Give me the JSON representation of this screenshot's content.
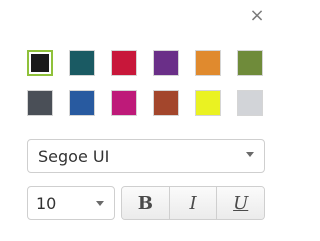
{
  "panel": {
    "close_glyph": "×",
    "close_icon": "close-icon"
  },
  "swatches": {
    "selected_index": 0,
    "row1": [
      {
        "name": "black",
        "color": "#1a1a1a"
      },
      {
        "name": "teal",
        "color": "#1a5a63"
      },
      {
        "name": "crimson",
        "color": "#c8173a"
      },
      {
        "name": "purple",
        "color": "#6a2f88"
      },
      {
        "name": "orange",
        "color": "#e08a2e"
      },
      {
        "name": "olive",
        "color": "#6f8b3a"
      }
    ],
    "row2": [
      {
        "name": "slate",
        "color": "#4a4f57"
      },
      {
        "name": "blue",
        "color": "#285aa0"
      },
      {
        "name": "magenta",
        "color": "#be1a79"
      },
      {
        "name": "brown",
        "color": "#a3462c"
      },
      {
        "name": "yellow",
        "color": "#eaf222"
      },
      {
        "name": "light-gray",
        "color": "#d2d4d8"
      }
    ]
  },
  "font": {
    "family": "Segoe UI"
  },
  "size": {
    "value": "10"
  },
  "style_buttons": {
    "bold": "B",
    "italic": "I",
    "underline": "U"
  }
}
